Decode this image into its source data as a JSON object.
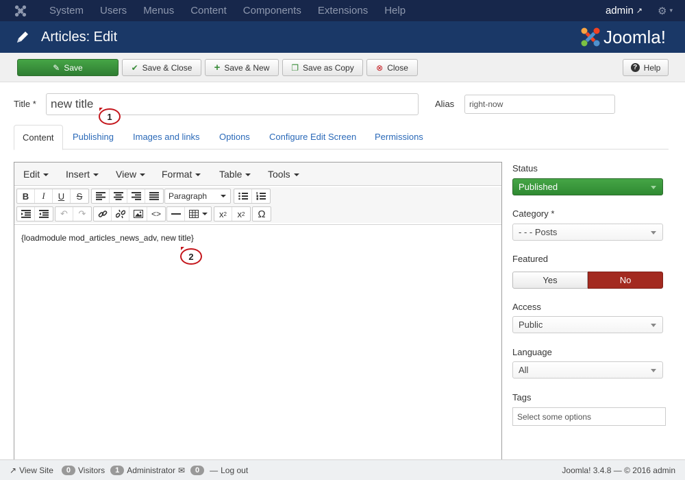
{
  "topbar": {
    "menu": [
      "System",
      "Users",
      "Menus",
      "Content",
      "Components",
      "Extensions",
      "Help"
    ],
    "user": "admin"
  },
  "header": {
    "title": "Articles: Edit",
    "brand": "Joomla!"
  },
  "toolbar": {
    "save": "Save",
    "save_close": "Save & Close",
    "save_new": "Save & New",
    "save_copy": "Save as Copy",
    "close": "Close",
    "help": "Help"
  },
  "form": {
    "title_label": "Title *",
    "title_value": "new title",
    "alias_label": "Alias",
    "alias_value": "right-now"
  },
  "callouts": [
    "1",
    "2"
  ],
  "tabs": [
    "Content",
    "Publishing",
    "Images and links",
    "Options",
    "Configure Edit Screen",
    "Permissions"
  ],
  "editor": {
    "menus": [
      "Edit",
      "Insert",
      "View",
      "Format",
      "Table",
      "Tools"
    ],
    "format_select": "Paragraph",
    "content": "{loadmodule mod_articles_news_adv, new title}"
  },
  "sidebar": {
    "status_label": "Status",
    "status_value": "Published",
    "category_label": "Category *",
    "category_value": "- - - Posts",
    "featured_label": "Featured",
    "featured_yes": "Yes",
    "featured_no": "No",
    "access_label": "Access",
    "access_value": "Public",
    "language_label": "Language",
    "language_value": "All",
    "tags_label": "Tags",
    "tags_placeholder": "Select some options"
  },
  "statusbar": {
    "view_site": "View Site",
    "visitors_count": "0",
    "visitors": "Visitors",
    "admins_count": "1",
    "administrator": "Administrator",
    "messages_count": "0",
    "logout": "Log out",
    "version": "Joomla! 3.4.8  —  © 2016 admin"
  },
  "colors": {
    "navbar": "#17274b",
    "header": "#1a3867",
    "save_green": "#46a546",
    "no_red": "#a32a20",
    "link": "#2a69b8"
  }
}
